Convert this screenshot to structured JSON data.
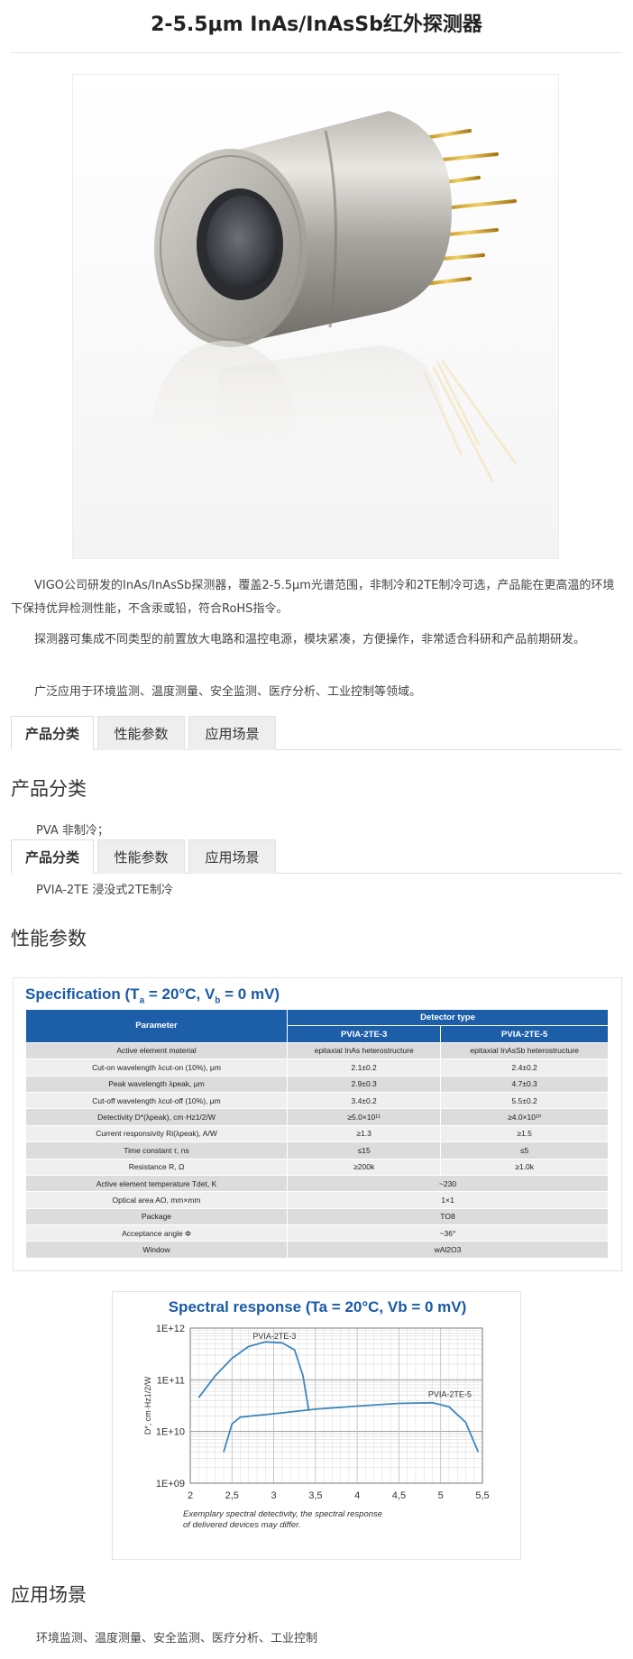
{
  "page": {
    "title": "2-5.5μm InAs/InAsSb红外探测器"
  },
  "intro": {
    "p1": "VIGO公司研发的InAs/InAsSb探测器，覆盖2-5.5μm光谱范围，非制冷和2TE制冷可选，产品能在更高温的环境下保持优异检测性能，不含汞或铅，符合RoHS指令。",
    "p2": "探测器可集成不同类型的前置放大电路和温控电源，模块紧凑，方便操作，非常适合科研和产品前期研发。",
    "p3": "广泛应用于环境监测、温度测量、安全监测、医疗分析、工业控制等领域。"
  },
  "tabs": [
    "产品分类",
    "性能参数",
    "应用场景"
  ],
  "categories": {
    "heading": "产品分类",
    "items": [
      "PVA 非制冷；",
      "PVIA-2TE 浸没式2TE制冷"
    ]
  },
  "performance": {
    "heading": "性能参数"
  },
  "spec": {
    "title": "Specification (T",
    "title_sub_a": "a",
    "title_mid": " = 20°C, V",
    "title_sub_b": "b",
    "title_end": " = 0 mV)",
    "col_parameter": "Parameter",
    "col_detector_type": "Detector type",
    "col_a": "PVIA-2TE-3",
    "col_b": "PVIA-2TE-5",
    "rows_split": [
      {
        "param": "Active element material",
        "a": "epitaxial InAs heterostructure",
        "b": "epitaxial InAsSb heterostructure"
      },
      {
        "param": "Cut-on wavelength λcut-on (10%), μm",
        "a": "2.1±0.2",
        "b": "2.4±0.2"
      },
      {
        "param": "Peak wavelength λpeak, μm",
        "a": "2.9±0.3",
        "b": "4.7±0.3"
      },
      {
        "param": "Cut-off wavelength λcut-off (10%), μm",
        "a": "3.4±0.2",
        "b": "5.5±0.2"
      },
      {
        "param": "Detectivity D*(λpeak), cm·Hz1/2/W",
        "a": "≥5.0×10¹¹",
        "b": "≥4.0×10¹⁰"
      },
      {
        "param": "Current responsivity Ri(λpeak), A/W",
        "a": "≥1.3",
        "b": "≥1.5"
      },
      {
        "param": "Time constant τ, ns",
        "a": "≤15",
        "b": "≤5"
      },
      {
        "param": "Resistance R, Ω",
        "a": "≥200k",
        "b": "≥1.0k"
      }
    ],
    "rows_merged": [
      {
        "param": "Active element temperature Tdet, K",
        "value": "~230"
      },
      {
        "param": "Optical area AO, mm×mm",
        "value": "1×1"
      },
      {
        "param": "Package",
        "value": "TO8"
      },
      {
        "param": "Acceptance angle Φ",
        "value": "~36°"
      },
      {
        "param": "Window",
        "value": "wAl2O3"
      }
    ]
  },
  "chart_data": {
    "type": "line",
    "title": "Spectral response (Ta = 20°C, Vb = 0 mV)",
    "ylabel": "D*, cm·Hz1/2/W",
    "xlabel": "",
    "x_ticks": [
      "2",
      "2,5",
      "3",
      "3,5",
      "4",
      "4,5",
      "5",
      "5,5"
    ],
    "y_ticks": [
      "1E+09",
      "1E+10",
      "1E+11",
      "1E+12"
    ],
    "xlim": [
      2,
      5.5
    ],
    "ylim_log10": [
      9,
      12
    ],
    "y_scale": "log",
    "grid": true,
    "caption": "Exemplary spectral detectivity, the spectral response of delivered devices may differ.",
    "series": [
      {
        "name": "PVIA-2TE-3",
        "x": [
          2.1,
          2.3,
          2.5,
          2.7,
          2.9,
          3.1,
          3.25,
          3.35,
          3.42
        ],
        "y": [
          45000000000.0,
          120000000000.0,
          260000000000.0,
          440000000000.0,
          540000000000.0,
          520000000000.0,
          380000000000.0,
          120000000000.0,
          25000000000.0
        ]
      },
      {
        "name": "PVIA-2TE-5",
        "x": [
          2.4,
          2.5,
          2.6,
          3.0,
          3.5,
          4.0,
          4.5,
          4.9,
          5.1,
          5.3,
          5.45
        ],
        "y": [
          4000000000.0,
          14000000000.0,
          19000000000.0,
          22000000000.0,
          27000000000.0,
          31000000000.0,
          35000000000.0,
          36000000000.0,
          30000000000.0,
          15000000000.0,
          4000000000.0
        ]
      }
    ]
  },
  "applications": {
    "heading": "应用场景",
    "text": "环境监测、温度测量、安全监测、医疗分析、工业控制"
  }
}
